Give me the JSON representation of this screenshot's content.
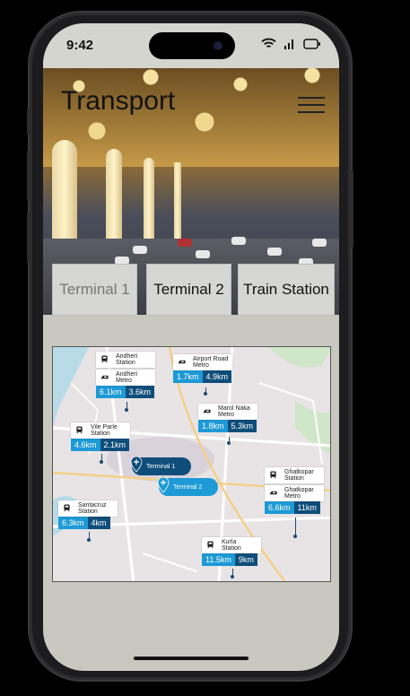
{
  "status": {
    "time": "9:42"
  },
  "header": {
    "title": "Transport",
    "menu_icon": "hamburger-menu-icon"
  },
  "tabs": [
    {
      "label": "Terminal 1",
      "active": true
    },
    {
      "label": "Terminal 2",
      "active": false
    },
    {
      "label": "Train Station",
      "active": false
    }
  ],
  "map": {
    "stations": [
      {
        "name": "Andheri\nStation",
        "mode": "train"
      },
      {
        "name": "Andheri\nMetro",
        "mode": "metro",
        "dist1": "6.1km",
        "dist2": "3.6km"
      },
      {
        "name": "Airport Road\nMetro",
        "mode": "metro",
        "dist1": "1.7km",
        "dist2": "4.9km"
      },
      {
        "name": "Marol Naka\nMetro",
        "mode": "metro",
        "dist1": "1.8km",
        "dist2": "5.3km"
      },
      {
        "name": "Vile Parle\nStation",
        "mode": "train",
        "dist1": "4.6km",
        "dist2": "2.1km"
      },
      {
        "name": "Ghatkopar\nStation",
        "mode": "train"
      },
      {
        "name": "Ghatkopar\nMetro",
        "mode": "metro",
        "dist1": "6.6km",
        "dist2": "11km"
      },
      {
        "name": "Santacruz\nStation",
        "mode": "train",
        "dist1": "6.3km",
        "dist2": "4km"
      },
      {
        "name": "Kurla\nStation",
        "mode": "train",
        "dist1": "11.5km",
        "dist2": "9km"
      }
    ],
    "terminals": [
      {
        "label": "Terminal 1",
        "color": "#0f4d7a"
      },
      {
        "label": "Terminal 2",
        "color": "#1e9ad6"
      }
    ],
    "colors": {
      "near": "#1e9ad6",
      "far": "#0f4d7a"
    }
  }
}
